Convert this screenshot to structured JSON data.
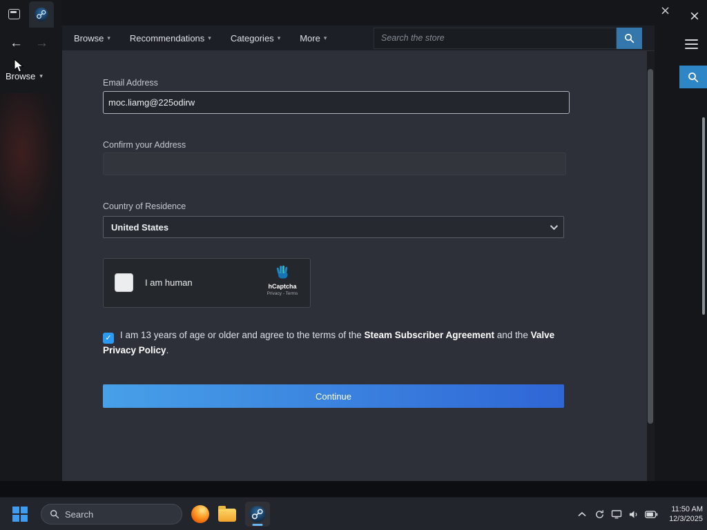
{
  "icons": {
    "close": "×",
    "back": "←",
    "forward": "→",
    "caret": "▾",
    "check": "✓"
  },
  "client": {
    "browse_label": "Browse",
    "nav": [
      {
        "label": "Browse"
      },
      {
        "label": "Recommendations"
      },
      {
        "label": "Categories"
      },
      {
        "label": "More"
      }
    ],
    "search_placeholder": "Search the store"
  },
  "form": {
    "email_label": "Email Address",
    "email_value": "moc.liamg@225odirw",
    "confirm_label": "Confirm your Address",
    "confirm_value": "",
    "country_label": "Country of Residence",
    "country_value": "United States",
    "captcha": {
      "checkbox_label": "I am human",
      "brand": "hCaptcha",
      "links": "Privacy - Terms"
    },
    "agreement": {
      "prefix": "I am 13 years of age or older and agree to the terms of the ",
      "link1": "Steam Subscriber Agreement",
      "middle": " and the ",
      "link2": "Valve Privacy Policy",
      "suffix": "."
    },
    "continue_label": "Continue"
  },
  "taskbar": {
    "search_placeholder": "Search",
    "time": "11:50 AM",
    "date": "12/3/2025"
  },
  "colors": {
    "accent_blue": "#2f86c7",
    "continue_gradient_from": "#47a0e8",
    "continue_gradient_to": "#2f66d6",
    "captcha_hand": "#1e9fd4",
    "agree_checkbox": "#2b9af3"
  }
}
